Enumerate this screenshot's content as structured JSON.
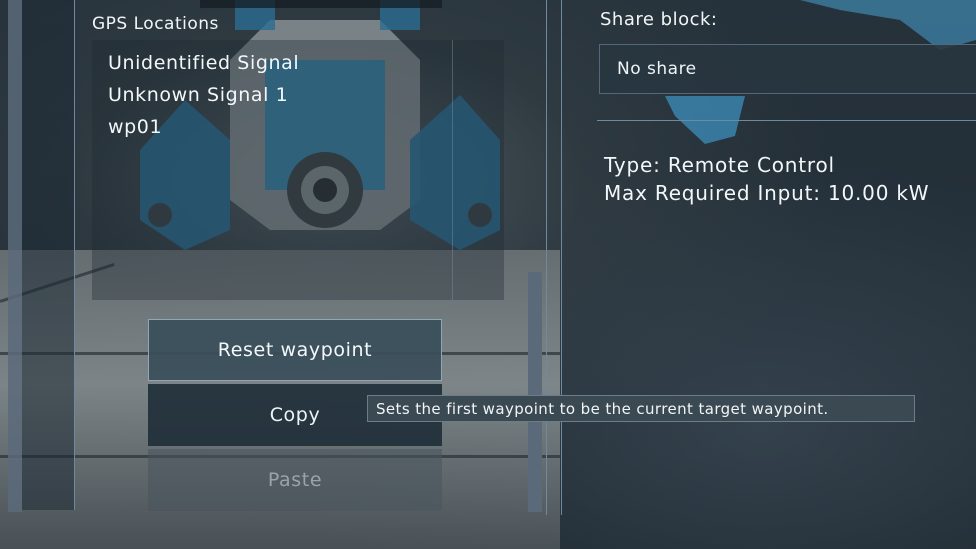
{
  "gps": {
    "title": "GPS Locations",
    "items": [
      "Unidentified Signal",
      "Unknown Signal 1",
      "wp01"
    ]
  },
  "buttons": {
    "reset": "Reset waypoint",
    "copy": "Copy",
    "paste": "Paste"
  },
  "tooltip": "Sets the first waypoint to be the current target waypoint.",
  "share": {
    "label": "Share block:",
    "value": "No share"
  },
  "info": {
    "type": "Type: Remote Control",
    "max_input": "Max Required Input: 10.00 kW"
  },
  "colors": {
    "panel_border": "#6f8aa0",
    "button_highlight": "#3a4e5a",
    "tooltip_bg": "#3a4952"
  }
}
